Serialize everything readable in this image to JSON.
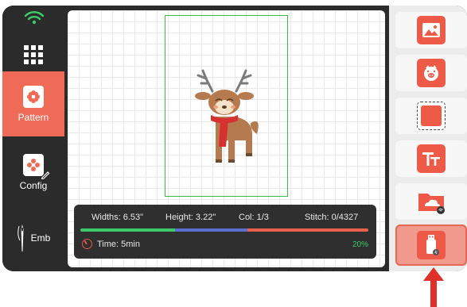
{
  "sidebar": {
    "items": [
      {
        "label": ""
      },
      {
        "label": "Pattern"
      },
      {
        "label": "Config"
      },
      {
        "label": "Emb"
      }
    ]
  },
  "status": {
    "widths": "Widths: 6.53\"",
    "height": "Height: 3.22\"",
    "col": "Col: 1/3",
    "stitch": "Stitch: 0/4327",
    "time": "Time: 5min",
    "percent": "20%"
  },
  "progress": {
    "segments": [
      {
        "color": "#3cc96a",
        "fraction": 0.33
      },
      {
        "color": "#5a6fd0",
        "fraction": 0.25
      },
      {
        "color": "#e8604c",
        "fraction": 0.42
      }
    ]
  },
  "right_panel": {
    "buttons": [
      "image-upload-icon",
      "pig-face-icon",
      "selection-frame-icon",
      "text-icon",
      "cloud-wifi-folder-icon",
      "usb-drive-icon"
    ]
  },
  "colors": {
    "accent": "#ef6b57",
    "hoop": "#3cb94a"
  }
}
